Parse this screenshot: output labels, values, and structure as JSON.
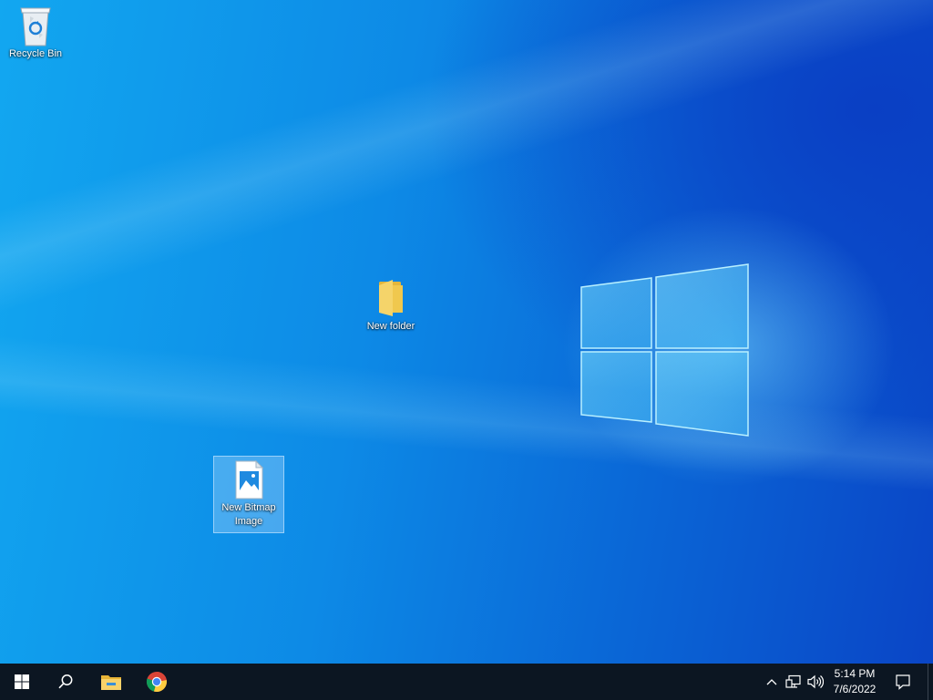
{
  "desktop": {
    "icons": [
      {
        "label": "Recycle Bin",
        "icon": "recycle-bin-icon"
      },
      {
        "label": "New folder",
        "icon": "folder-icon"
      },
      {
        "label": "New Bitmap Image",
        "icon": "bitmap-image-icon",
        "selected": true
      }
    ]
  },
  "taskbar": {
    "buttons": [
      {
        "name": "start",
        "icon": "windows-start-icon"
      },
      {
        "name": "search",
        "icon": "search-icon"
      },
      {
        "name": "file-explorer",
        "icon": "file-explorer-icon"
      },
      {
        "name": "chrome",
        "icon": "chrome-icon"
      }
    ],
    "tray": {
      "icons": [
        "chevron-up-icon",
        "network-icon",
        "volume-icon"
      ],
      "time": "5:14 PM",
      "date": "7/6/2022",
      "notification_icon": "action-center-icon"
    }
  },
  "colors": {
    "taskbar_bg": "#0c1622",
    "desktop_accent": "#0d8ae6"
  }
}
